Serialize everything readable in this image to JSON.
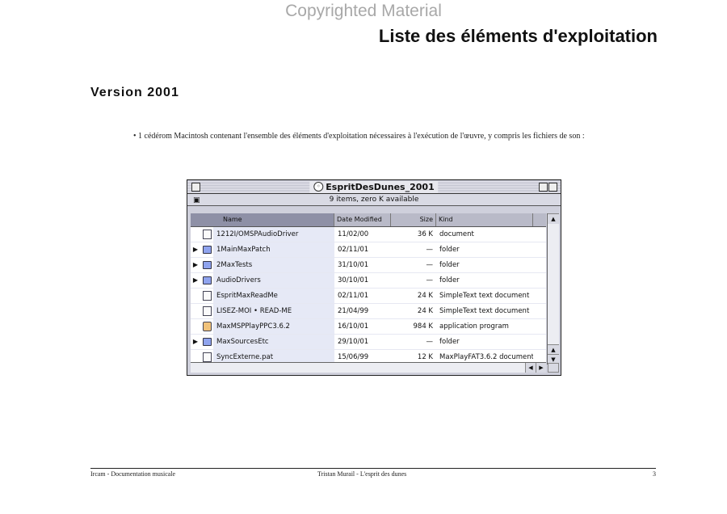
{
  "watermark": "Copyrighted Material",
  "doc_title": "Liste des éléments d'exploitation",
  "version_heading": "Version 2001",
  "bullet": "• 1 cédérom Macintosh contenant l'ensemble des éléments d'exploitation nécessaires à l'exécution de l'œuvre, y compris les fichiers de son :",
  "finder": {
    "title": "EspritDesDunes_2001",
    "info": "9 items, zero K available",
    "columns": {
      "name": "Name",
      "date": "Date Modified",
      "size": "Size",
      "kind": "Kind"
    },
    "rows": [
      {
        "name": "1212I/OMSPAudioDriver",
        "date": "11/02/00",
        "size": "36 K",
        "kind": "document",
        "icon": "document-icon",
        "expandable": false
      },
      {
        "name": "1MainMaxPatch",
        "date": "02/11/01",
        "size": "—",
        "kind": "folder",
        "icon": "folder-icon",
        "expandable": true
      },
      {
        "name": "2MaxTests",
        "date": "31/10/01",
        "size": "—",
        "kind": "folder",
        "icon": "folder-icon",
        "expandable": true
      },
      {
        "name": "AudioDrivers",
        "date": "30/10/01",
        "size": "—",
        "kind": "folder",
        "icon": "folder-icon",
        "expandable": true
      },
      {
        "name": "EspritMaxReadMe",
        "date": "02/11/01",
        "size": "24 K",
        "kind": "SimpleText text document",
        "icon": "text-document-icon",
        "expandable": false
      },
      {
        "name": "LISEZ-MOI • READ-ME",
        "date": "21/04/99",
        "size": "24 K",
        "kind": "SimpleText text document",
        "icon": "text-document-icon",
        "expandable": false
      },
      {
        "name": "MaxMSPPlayPPC3.6.2",
        "date": "16/10/01",
        "size": "984 K",
        "kind": "application program",
        "icon": "application-icon",
        "expandable": false
      },
      {
        "name": "MaxSourcesEtc",
        "date": "29/10/01",
        "size": "—",
        "kind": "folder",
        "icon": "folder-icon",
        "expandable": true
      },
      {
        "name": "SyncExterne.pat",
        "date": "15/06/99",
        "size": "12 K",
        "kind": "MaxPlayFAT3.6.2 document",
        "icon": "document-icon",
        "expandable": false
      }
    ]
  },
  "footer": {
    "left": "Ircam - Documentation musicale",
    "center": "Tristan Murail - L'esprit des dunes",
    "right": "3"
  }
}
